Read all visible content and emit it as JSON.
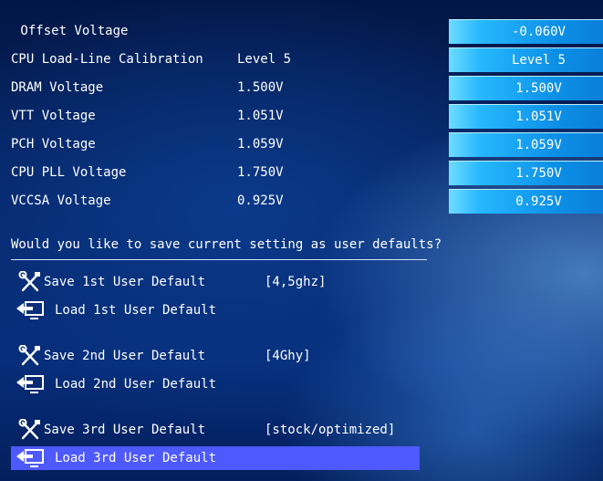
{
  "settings": [
    {
      "label": " Offset Voltage",
      "value": "",
      "box": "-0.060V"
    },
    {
      "label": "CPU Load-Line Calibration",
      "value": "Level 5",
      "box": "Level 5"
    },
    {
      "label": "DRAM Voltage",
      "value": "1.500V",
      "box": "1.500V"
    },
    {
      "label": "VTT Voltage",
      "value": "1.051V",
      "box": "1.051V"
    },
    {
      "label": "PCH Voltage",
      "value": "1.059V",
      "box": "1.059V"
    },
    {
      "label": "CPU PLL Voltage",
      "value": "1.750V",
      "box": "1.750V"
    },
    {
      "label": "VCCSA Voltage",
      "value": "0.925V",
      "box": "0.925V"
    }
  ],
  "prompt": "Would you like to save current setting as user defaults?",
  "user_defaults": [
    {
      "save": "Save 1st User Default",
      "note": "[4,5ghz]",
      "load": "Load 1st User Default"
    },
    {
      "save": "Save 2nd User Default",
      "note": "[4Ghy]",
      "load": "Load 2nd User Default"
    },
    {
      "save": "Save 3rd User Default",
      "note": "[stock/optimized]",
      "load": "Load 3rd User Default"
    }
  ],
  "colors": {
    "selection": "#4e59ff",
    "accent_box": "#27b8ff"
  }
}
